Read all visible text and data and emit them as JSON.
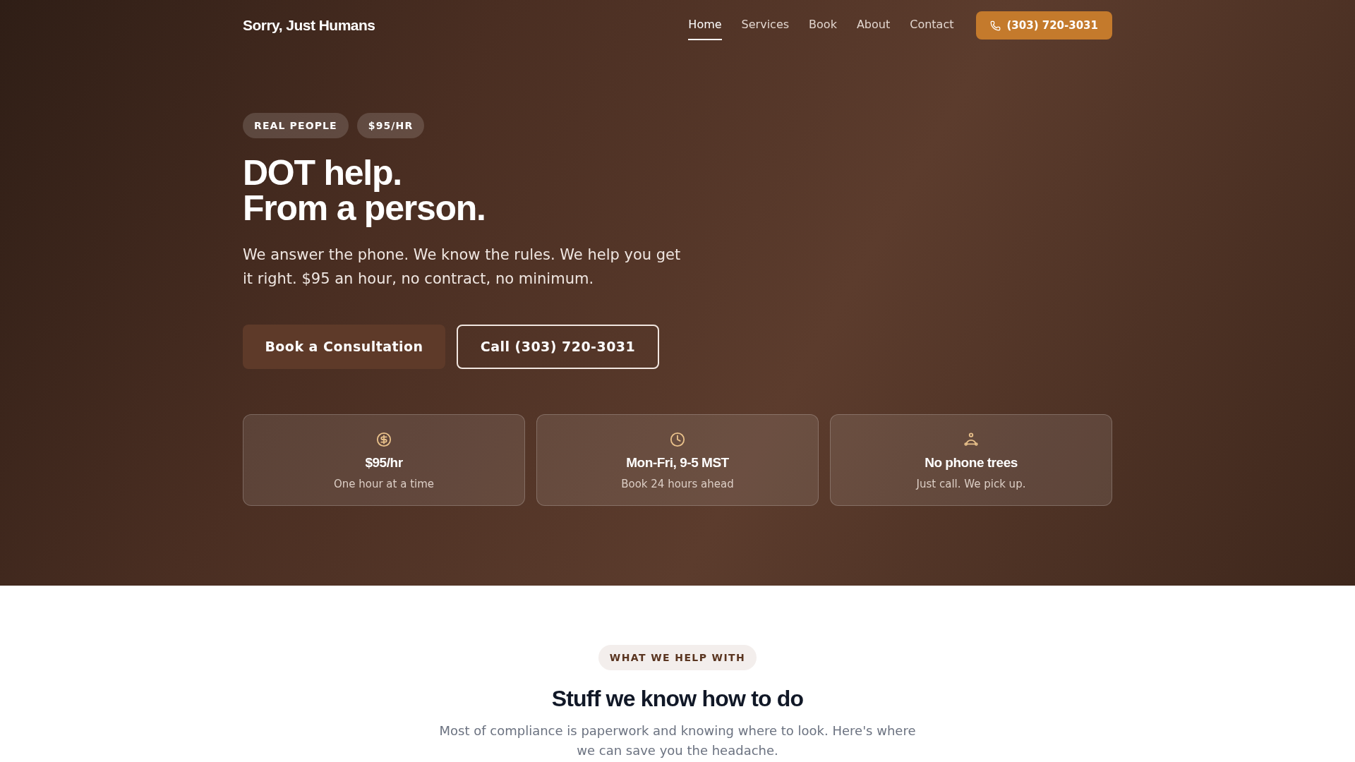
{
  "header": {
    "logo": "Sorry, Just Humans",
    "nav": [
      {
        "label": "Home",
        "selected": true
      },
      {
        "label": "Services",
        "selected": false
      },
      {
        "label": "Book",
        "selected": false
      },
      {
        "label": "About",
        "selected": false
      },
      {
        "label": "Contact",
        "selected": false
      }
    ],
    "phone_button": "(303) 720-3031"
  },
  "hero": {
    "badges": [
      "REAL PEOPLE",
      "$95/HR"
    ],
    "heading_lines": [
      "DOT help.",
      "From a person."
    ],
    "intro": "We answer the phone. We know the rules. We help you get it right. $95 an hour, no contract, no minimum.",
    "buttons": [
      {
        "kind": "solid",
        "label": "Book a Consultation"
      },
      {
        "kind": "outline",
        "label": "Call (303) 720-3031"
      }
    ],
    "features": [
      {
        "kind": "dollar",
        "title": "$95/hr",
        "subtitle": "One hour at a time"
      },
      {
        "kind": "clock",
        "title": "Mon-Fri, 9-5 MST",
        "subtitle": "Book 24 hours ahead"
      },
      {
        "kind": "person",
        "title": "No phone trees",
        "subtitle": "Just call. We pick up."
      }
    ]
  },
  "services": {
    "eyebrow": "WHAT WE HELP WITH",
    "heading": "Stuff we know how to do",
    "intro": "Most of compliance is paperwork and knowing where to look. Here's where we can save you the headache."
  }
}
